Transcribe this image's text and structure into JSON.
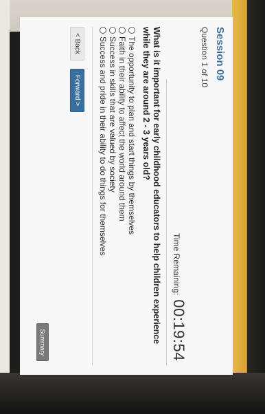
{
  "session": {
    "title": "Session 09",
    "question_count": "Question 1 of 10"
  },
  "timer": {
    "label": "Time Remaining:",
    "value": "00:19:54"
  },
  "question": {
    "text": "What is it important for early childhood educators to help children experience while they are around 2 - 3 years old?",
    "answers": [
      "The opportunity to plan and start things by themselves",
      "Faith in their ability to affect the world around them",
      "Success in skills that are valued by society",
      "Success and pride in their ability to do things for themselves"
    ]
  },
  "navigation": {
    "back_label": "< Back",
    "forward_label": "Forward >",
    "summary_label": "Summary"
  }
}
